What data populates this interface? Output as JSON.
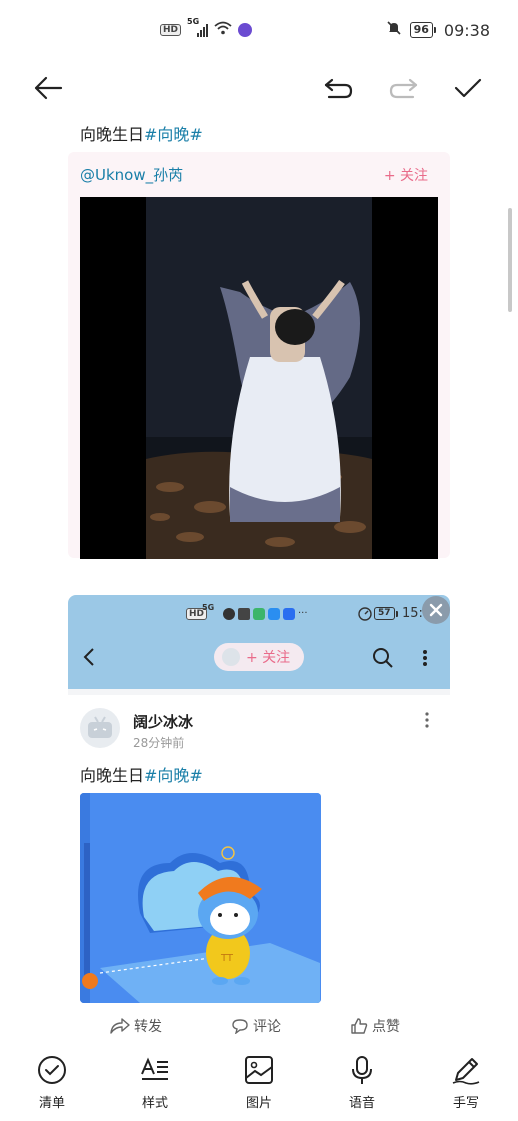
{
  "status_bar": {
    "hd": "HD",
    "signal": "5G",
    "battery": "96",
    "time": "09:38"
  },
  "toolbar": {
    "back_icon": "arrow-left-icon",
    "undo_icon": "undo-icon",
    "redo_icon": "redo-icon",
    "done_icon": "check-icon"
  },
  "post1": {
    "text": "向晚生日",
    "tag": "#向晚#",
    "user": "@Uknow_孙芮",
    "follow": "+ 关注"
  },
  "card2": {
    "inner_status": {
      "hd": "HD",
      "signal": "5G",
      "battery": "57",
      "time": "15:13"
    },
    "follow": "+ 关注",
    "author": "阔少冰冰",
    "time_ago": "28分钟前",
    "text": "向晚生日",
    "tag": "#向晚#",
    "image_label": "TT"
  },
  "actions": {
    "share": "转发",
    "comment": "评论",
    "like": "点赞"
  },
  "bottom_bar": {
    "items": [
      {
        "label": "清单",
        "icon": "checklist-icon"
      },
      {
        "label": "样式",
        "icon": "text-style-icon"
      },
      {
        "label": "图片",
        "icon": "image-icon"
      },
      {
        "label": "语音",
        "icon": "microphone-icon"
      },
      {
        "label": "手写",
        "icon": "pen-icon"
      }
    ]
  },
  "colors": {
    "tag": "#1a7fa8",
    "follow": "#e96b8a",
    "card2_header": "#9bc8e6",
    "image_bg": "#4a8cf0"
  }
}
